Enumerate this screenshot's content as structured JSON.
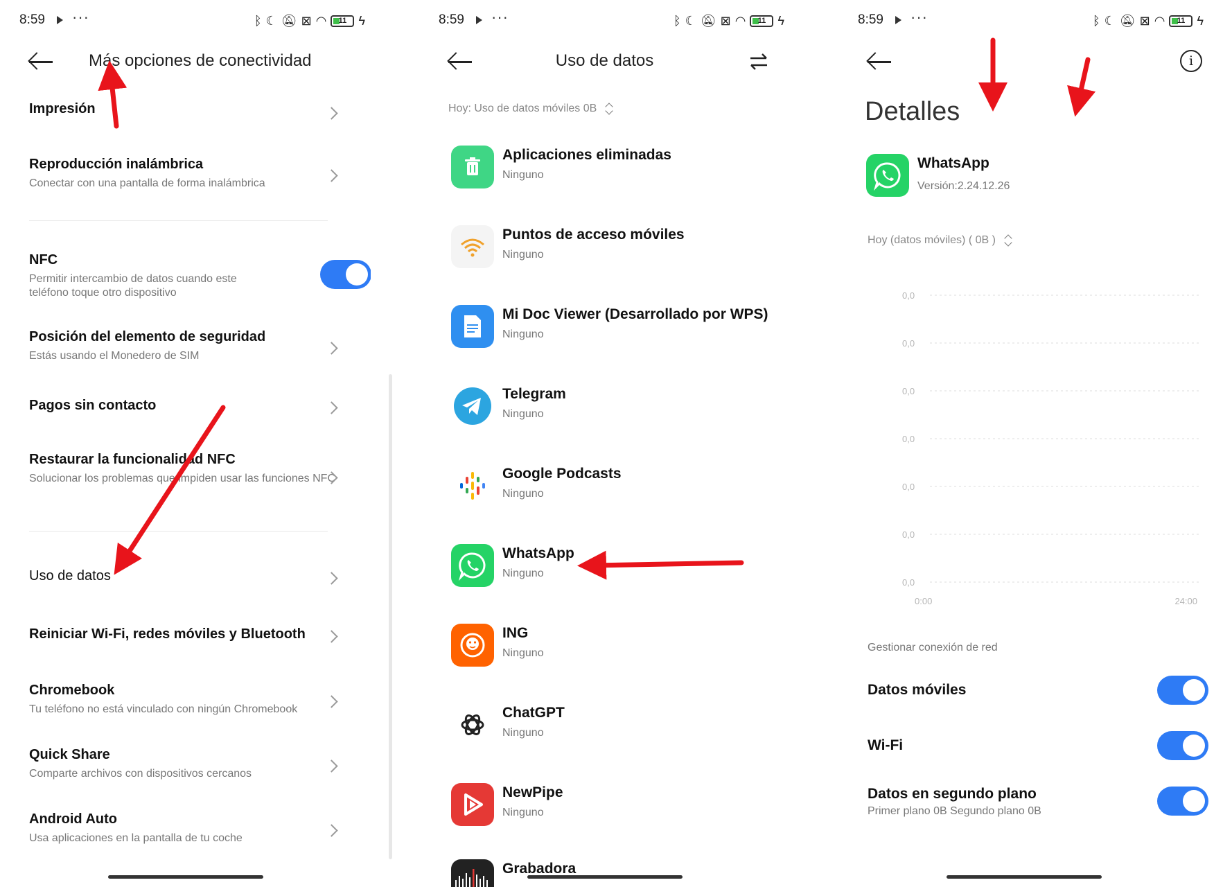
{
  "status": {
    "time": "8:59",
    "battery": "11",
    "icons": [
      "bluetooth-icon",
      "moon-icon",
      "muted-icon",
      "sim-off-icon",
      "wifi-icon",
      "battery-icon",
      "charging-icon"
    ]
  },
  "screen1": {
    "title": "Más opciones de conectividad",
    "rows": [
      {
        "title": "Impresión",
        "subtitle": ""
      },
      {
        "title": "Reproducción inalámbrica",
        "subtitle": "Conectar con una pantalla de forma inalámbrica"
      },
      {
        "title": "NFC",
        "subtitle": "Permitir intercambio de datos cuando este teléfono toque otro dispositivo",
        "toggle": true
      },
      {
        "title": "Posición del elemento de seguridad",
        "subtitle": "Estás usando el Monedero de SIM"
      },
      {
        "title": "Pagos sin contacto",
        "subtitle": ""
      },
      {
        "title": "Restaurar la funcionalidad NFC",
        "subtitle": "Solucionar los problemas que impiden usar las funciones NFC"
      },
      {
        "title": "Uso de datos",
        "subtitle": ""
      },
      {
        "title": "Reiniciar Wi-Fi, redes móviles y Bluetooth",
        "subtitle": ""
      },
      {
        "title": "Chromebook",
        "subtitle": "Tu teléfono no está vinculado con ningún Chromebook"
      },
      {
        "title": "Quick Share",
        "subtitle": "Comparte archivos con dispositivos cercanos"
      },
      {
        "title": "Android Auto",
        "subtitle": "Usa aplicaciones en la pantalla de tu coche"
      }
    ]
  },
  "screen2": {
    "title": "Uso de datos",
    "today": "Hoy: Uso de datos móviles 0B",
    "apps": [
      {
        "name": "Aplicaciones eliminadas",
        "usage": "Ninguno",
        "icon": "trash-icon",
        "color": "#3fd685"
      },
      {
        "name": "Puntos de acceso móviles",
        "usage": "Ninguno",
        "icon": "hotspot-icon",
        "color": "#f3f3f3"
      },
      {
        "name": "Mi Doc Viewer (Desarrollado por WPS)",
        "usage": "Ninguno",
        "icon": "document-icon",
        "color": "#2f8ff0"
      },
      {
        "name": "Telegram",
        "usage": "Ninguno",
        "icon": "telegram-icon",
        "color": "#2ca5e0"
      },
      {
        "name": "Google Podcasts",
        "usage": "Ninguno",
        "icon": "podcasts-icon",
        "color": "#ffffff"
      },
      {
        "name": "WhatsApp",
        "usage": "Ninguno",
        "icon": "whatsapp-icon",
        "color": "#25d366"
      },
      {
        "name": "ING",
        "usage": "Ninguno",
        "icon": "ing-lion-icon",
        "color": "#ff6200"
      },
      {
        "name": "ChatGPT",
        "usage": "Ninguno",
        "icon": "chatgpt-icon",
        "color": "#ffffff"
      },
      {
        "name": "NewPipe",
        "usage": "Ninguno",
        "icon": "newpipe-icon",
        "color": "#e53935"
      },
      {
        "name": "Grabadora",
        "usage": "",
        "icon": "recorder-icon",
        "color": "#222222"
      }
    ]
  },
  "screen3": {
    "heading": "Detalles",
    "app_name": "WhatsApp",
    "version": "Versión:2.24.12.26",
    "period": "Hoy (datos móviles) ( 0B )",
    "section": "Gestionar conexión de red",
    "toggles": [
      {
        "label": "Datos móviles",
        "sub": "",
        "on": true
      },
      {
        "label": "Wi-Fi",
        "sub": "",
        "on": true
      },
      {
        "label": "Datos en segundo plano",
        "sub": "Primer plano 0B  Segundo plano 0B",
        "on": true
      }
    ]
  },
  "chart_data": {
    "type": "line",
    "x": [
      "0:00",
      "24:00"
    ],
    "yticks": [
      "0,0",
      "0,0",
      "0,0",
      "0,0",
      "0,0",
      "0,0",
      "0,0"
    ],
    "series": [],
    "grid": true
  },
  "colors": {
    "accent": "#2e7bf5",
    "annotation_arrow": "#e8141b"
  }
}
